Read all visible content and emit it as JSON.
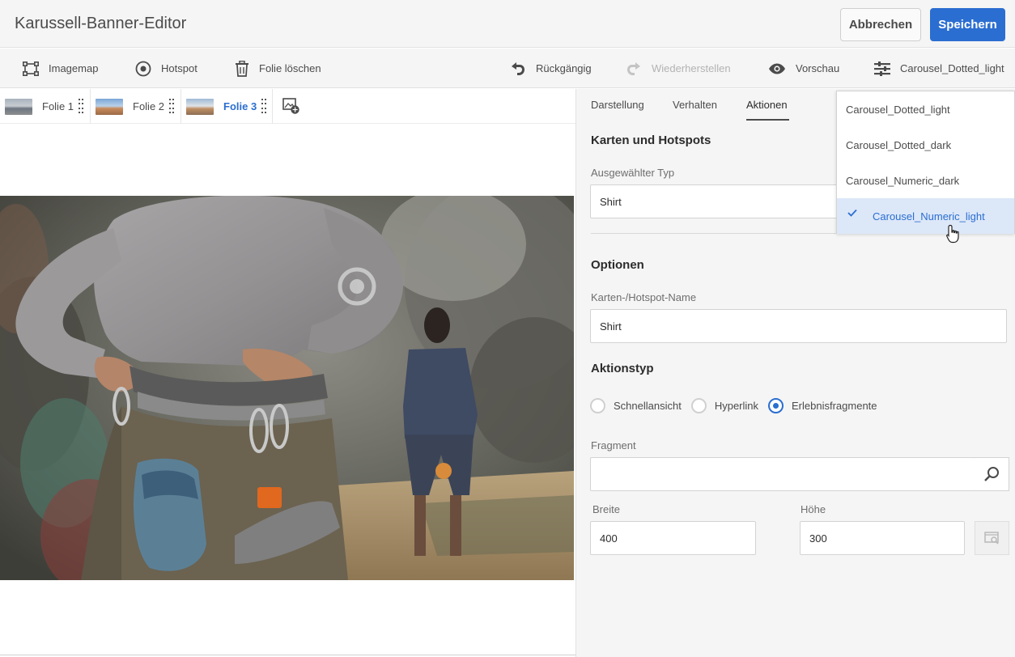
{
  "header": {
    "title": "Karussell-Banner-Editor",
    "cancel_label": "Abbrechen",
    "save_label": "Speichern"
  },
  "toolbar": {
    "imagemap_label": "Imagemap",
    "hotspot_label": "Hotspot",
    "delete_slide_label": "Folie löschen",
    "undo_label": "Rückgängig",
    "redo_label": "Wiederherstellen",
    "preview_label": "Vorschau",
    "preset_label": "Carousel_Dotted_light"
  },
  "slides": [
    {
      "label": "Folie 1"
    },
    {
      "label": "Folie 2"
    },
    {
      "label": "Folie 3",
      "active": true
    }
  ],
  "panel": {
    "tabs": [
      "Darstellung",
      "Verhalten",
      "Aktionen"
    ],
    "active_tab": "Aktionen",
    "section_maps": "Karten und Hotspots",
    "selected_type_label": "Ausgewählter Typ",
    "selected_type_value": "Shirt",
    "section_options": "Optionen",
    "name_label": "Karten-/Hotspot-Name",
    "name_value": "Shirt",
    "section_action_type": "Aktionstyp",
    "action_types": [
      "Schnellansicht",
      "Hyperlink",
      "Erlebnisfragmente"
    ],
    "selected_action": "Erlebnisfragmente",
    "fragment_label": "Fragment",
    "fragment_value": "",
    "width_label": "Breite",
    "width_value": "400",
    "height_label": "Höhe",
    "height_value": "300"
  },
  "dropdown": {
    "options": [
      "Carousel_Dotted_light",
      "Carousel_Dotted_dark",
      "Carousel_Numeric_dark",
      "Carousel_Numeric_light"
    ],
    "selected": "Carousel_Numeric_light"
  },
  "colors": {
    "accent": "#2b6ed1",
    "header_bg": "#f5f5f5",
    "selected_bg": "#dce7f8"
  }
}
